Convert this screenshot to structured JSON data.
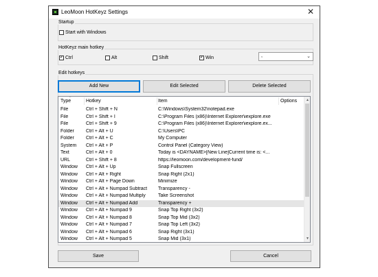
{
  "window": {
    "title": "LeoMoon HotKeyz Settings",
    "close_glyph": "✕"
  },
  "startup": {
    "group_label": "Startup",
    "start_with_windows": {
      "label": "Start with Windows",
      "checked": false
    }
  },
  "main_hotkey": {
    "group_label": "HotKeyz main hotkey",
    "ctrl": {
      "label": "Ctrl",
      "checked": true
    },
    "alt": {
      "label": "Alt",
      "checked": false
    },
    "shift": {
      "label": "Shift",
      "checked": false
    },
    "win": {
      "label": "Win",
      "checked": true
    },
    "key_select": {
      "value": ",",
      "options": [
        ","
      ]
    }
  },
  "edit_hotkeys": {
    "group_label": "Edit hotkeys",
    "add_new_label": "Add New",
    "edit_selected_label": "Edit Selected",
    "delete_selected_label": "Delete Selected",
    "columns": {
      "type": "Type",
      "hotkey": "Hotkey",
      "item": "Item",
      "options": "Options"
    },
    "selected_row_index": 13,
    "rows": [
      {
        "type": "File",
        "hotkey": "Ctrl + Shift + N",
        "item": "C:\\Windows\\System32\\notepad.exe"
      },
      {
        "type": "File",
        "hotkey": "Ctrl + Shift + I",
        "item": "C:\\Program Files (x86)\\Internet Explorer\\iexplore.exe"
      },
      {
        "type": "File",
        "hotkey": "Ctrl + Shift + 9",
        "item": "C:\\Program Files (x86)\\Internet Explorer\\iexplore.ex..."
      },
      {
        "type": "Folder",
        "hotkey": "Ctrl + Alt + U",
        "item": "C:\\Users\\PC"
      },
      {
        "type": "Folder",
        "hotkey": "Ctrl + Alt + C",
        "item": "My Computer"
      },
      {
        "type": "System",
        "hotkey": "Ctrl + Alt + P",
        "item": "Control Panel (Category View)"
      },
      {
        "type": "Text",
        "hotkey": "Ctrl + Alt + 0",
        "item": "Today is <DAYNAME>[New Line]Current time is: <..."
      },
      {
        "type": "URL",
        "hotkey": "Ctrl + Shift + 8",
        "item": "https://leomoon.com/development-fund/"
      },
      {
        "type": "Window",
        "hotkey": "Ctrl + Alt + Up",
        "item": "Snap Fullscreen"
      },
      {
        "type": "Window",
        "hotkey": "Ctrl + Alt + Right",
        "item": "Snap Right (2x1)"
      },
      {
        "type": "Window",
        "hotkey": "Ctrl + Alt + Page Down",
        "item": "Minimize"
      },
      {
        "type": "Window",
        "hotkey": "Ctrl + Alt + Numpad Subtract",
        "item": "Transparency -"
      },
      {
        "type": "Window",
        "hotkey": "Ctrl + Alt + Numpad Multiply",
        "item": "Take Screenshot"
      },
      {
        "type": "Window",
        "hotkey": "Ctrl + Alt + Numpad Add",
        "item": "Transparency +"
      },
      {
        "type": "Window",
        "hotkey": "Ctrl + Alt + Numpad 9",
        "item": "Snap Top Right (3x2)"
      },
      {
        "type": "Window",
        "hotkey": "Ctrl + Alt + Numpad 8",
        "item": "Snap Top Mid (3x2)"
      },
      {
        "type": "Window",
        "hotkey": "Ctrl + Alt + Numpad 7",
        "item": "Snap Top Left (3x2)"
      },
      {
        "type": "Window",
        "hotkey": "Ctrl + Alt + Numpad 6",
        "item": "Snap Right (3x1)"
      },
      {
        "type": "Window",
        "hotkey": "Ctrl + Alt + Numpad 5",
        "item": "Snap Mid (3x1)"
      }
    ]
  },
  "footer": {
    "save_label": "Save",
    "cancel_label": "Cancel"
  },
  "colors": {
    "window_bg": "#f0f0f0",
    "focus_border": "#0078d7",
    "selected_row": "#e5e5e5"
  }
}
